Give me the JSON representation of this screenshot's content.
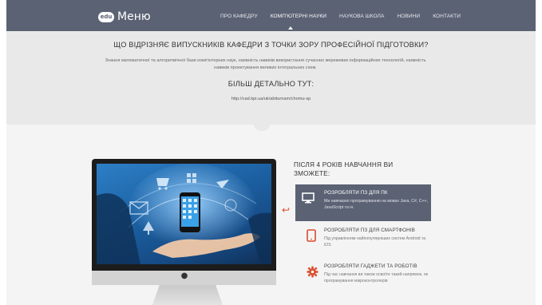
{
  "nav": {
    "logo_badge": "edu",
    "logo_text": "Меню",
    "items": [
      {
        "label": "ПРО КАФЕДРУ"
      },
      {
        "label": "КОМП'ЮТЕРНІ НАУКИ"
      },
      {
        "label": "НАУКОВА ШКОЛА"
      },
      {
        "label": "НОВИНИ"
      },
      {
        "label": "КОНТАКТИ"
      }
    ],
    "active_index": 1
  },
  "info": {
    "heading": "ЩО ВІДРІЗНЯЄ ВИПУСКНИКІВ КАФЕДРИ З ТОЧКИ ЗОРУ ПРОФЕСІЙНОЇ ПІДГОТОВКИ?",
    "paragraph": "Знання математичної та алгоритмічної бази комп'ютерних наук, наявність навиків використання сучасних мережевих інформаційних технологій, наявність навиків проектування великих інтегральних схем.",
    "subheading": "БІЛЬШ ДЕТАЛЬНО ТУТ:",
    "link": "http://cad.kpi.ua/uk/abiturnam/chomu-sp"
  },
  "features": {
    "title": "ПІСЛЯ 4 РОКІВ НАВЧАННЯ ВИ ЗМОЖЕТЕ:",
    "items": [
      {
        "icon": "monitor-icon",
        "title": "РОЗРОБЛЯТИ ПЗ ДЛЯ ПК",
        "text": "Ми навчаємо програмуванню на мовах Java, C#, C++, JavaScript та ін."
      },
      {
        "icon": "tablet-icon",
        "title": "РОЗРОБЛЯТИ ПЗ ДЛЯ СМАРТФОНІВ",
        "text": "Під управлінням найпопулярніших систем Android та iOS"
      },
      {
        "icon": "gear-icon",
        "title": "РОЗРОБЛЯТИ ГАДЖЕТИ ТА РОБОТІВ",
        "text": "Під час навчання ви також освоїте такий напрямок, як програмування мікроконтролерів"
      }
    ]
  },
  "colors": {
    "nav_bg": "#5b6274",
    "accent": "#d94b2b",
    "band_bg": "#e9e9e9"
  }
}
